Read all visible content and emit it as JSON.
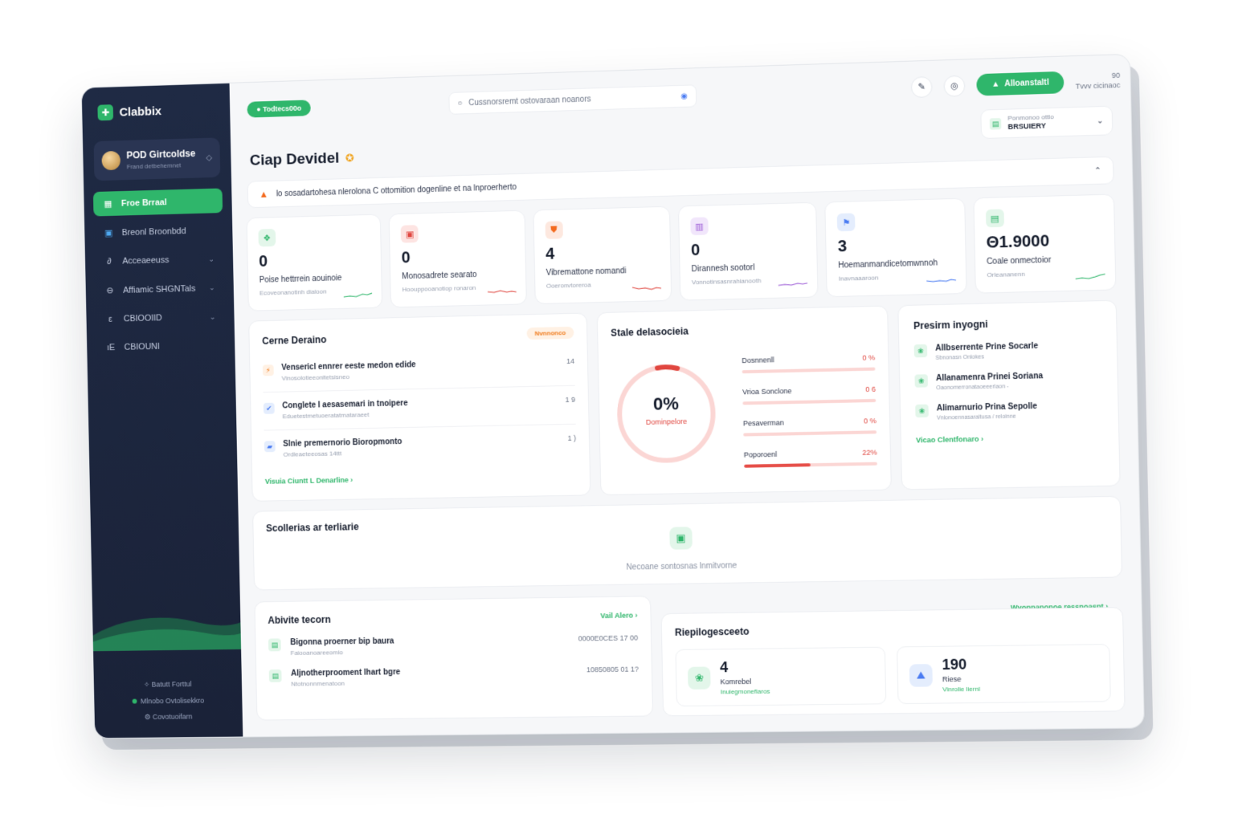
{
  "colors": {
    "accent": "#2fb66b",
    "sidebar": "#1f2a44",
    "warning": "#f36a1e",
    "danger": "#e0463f"
  },
  "sidebar": {
    "brand": "Clabbix",
    "profile": {
      "name": "POD Girtcoldse",
      "sub": "Frand detbehemnet"
    },
    "items": [
      {
        "label": "Froe Brraal",
        "icon": "dashboard-icon"
      },
      {
        "label": "Breonl Broonbdd",
        "icon": "book-icon"
      },
      {
        "label": "Acceaeeuss",
        "icon": "link-icon"
      },
      {
        "label": "Affiamic SHGNTals",
        "icon": "shield-icon"
      },
      {
        "label": "CBIOOIID",
        "icon": "folder-icon"
      },
      {
        "label": "CBIOUNI",
        "icon": "chart-icon"
      }
    ],
    "footer": {
      "help": "Batutt Forttul",
      "status": "Mlnobo Ovtolisekkro",
      "version": "Covotuoifarn"
    }
  },
  "topbar": {
    "pill": "Todtecs00o",
    "search_placeholder": "Cussnorsremt ostovaraan noanors",
    "cta": "Alloanstaltl",
    "user_line1": "90",
    "user_line2": "Tvvv cicinaoc"
  },
  "selector": {
    "label": "Ponmonoo ottlo",
    "value": "BRSUIERY"
  },
  "title": "Ciap Devidel",
  "alert": "lo sosadartohesa nlerolona C ottomition dogenline et na lnproerherto",
  "stats": [
    {
      "value": "0",
      "label": "Poise hettrrein aouinoie",
      "sub": "Ecoveonanotinh dialoon"
    },
    {
      "value": "0",
      "label": "Monosadrete searato",
      "sub": "Hoouppooanotiop ronaron"
    },
    {
      "value": "4",
      "label": "Vibremattone nomandi",
      "sub": "Ooeronvtoreroa"
    },
    {
      "value": "0",
      "label": "Dirannesh sootorl",
      "sub": "Vonnotinsasnrahianooth"
    },
    {
      "value": "3",
      "label": "Hoemanmandicetomwnnoh",
      "sub": "Inavnaaaroon"
    },
    {
      "value": "Θ1.9000",
      "label": "Coale onmectoior",
      "sub": "Orleananenn"
    }
  ],
  "tasks": {
    "title": "Cerne Deraino",
    "chip": "Nvnnonco",
    "items": [
      {
        "name": "Vensericl ennrer eeste medon edide",
        "sub": "Vinosolotieeonitetsisneo",
        "count": "14"
      },
      {
        "name": "Conglete I aesasemari in tnoipere",
        "sub": "Eduetestmetuoeratatmataraeet",
        "count": "1 9"
      },
      {
        "name": "Slnie premernorio Bioropmonto",
        "sub": "Ordleaeteeosas 14ttt",
        "count": "1 )"
      }
    ],
    "link": "Visuia Ciuntt L Denarline"
  },
  "status": {
    "title": "Stale delasocieia",
    "ring_value": "0%",
    "ring_label": "Dominpelore",
    "rows": [
      {
        "label": "Dosnnenll",
        "pct": "0 %"
      },
      {
        "label": "Vrioa Sonclone",
        "pct": "0 6"
      },
      {
        "label": "Pesaverman",
        "pct": "0 %"
      },
      {
        "label": "Poporoenl",
        "pct": "22%"
      }
    ]
  },
  "priority": {
    "title": "Presirm inyogni",
    "items": [
      {
        "name": "Allbserrente Prine Socarle",
        "sub": "Sbnonasn Onlokes"
      },
      {
        "name": "Allanamenra Prinei Soriana",
        "sub": "Oaonomerronataoeeerlaon -"
      },
      {
        "name": "Alimarnurio Prina Sepolle",
        "sub": "Vnlonoennasaraltusa / reloinne"
      }
    ],
    "link": "Vicao Clentfonaro"
  },
  "empty": {
    "title": "Scollerias ar terliarie",
    "message": "Necoane sontosnas lnmitvorne"
  },
  "activity": {
    "title": "Abivite tecorn",
    "link": "Vail Alero",
    "items": [
      {
        "name": "Bigonna proerner bip baura",
        "sub": "Faiooanoareeomio",
        "meta": "0000E0CES  17 00"
      },
      {
        "name": "Aljnotherprooment lhart bgre",
        "sub": "Ntotnonnmenatoon",
        "meta": "10850805  01 1?"
      }
    ]
  },
  "bottom_link": "Wvonnanonoe ressnoasnt",
  "summary": {
    "title": "Riepilogesceeto",
    "items": [
      {
        "value": "4",
        "label": "Komrebel",
        "sub": "Inuiegmoneflaros"
      },
      {
        "value": "190",
        "label": "Riese",
        "sub": "Vinrolie liernl"
      }
    ]
  }
}
